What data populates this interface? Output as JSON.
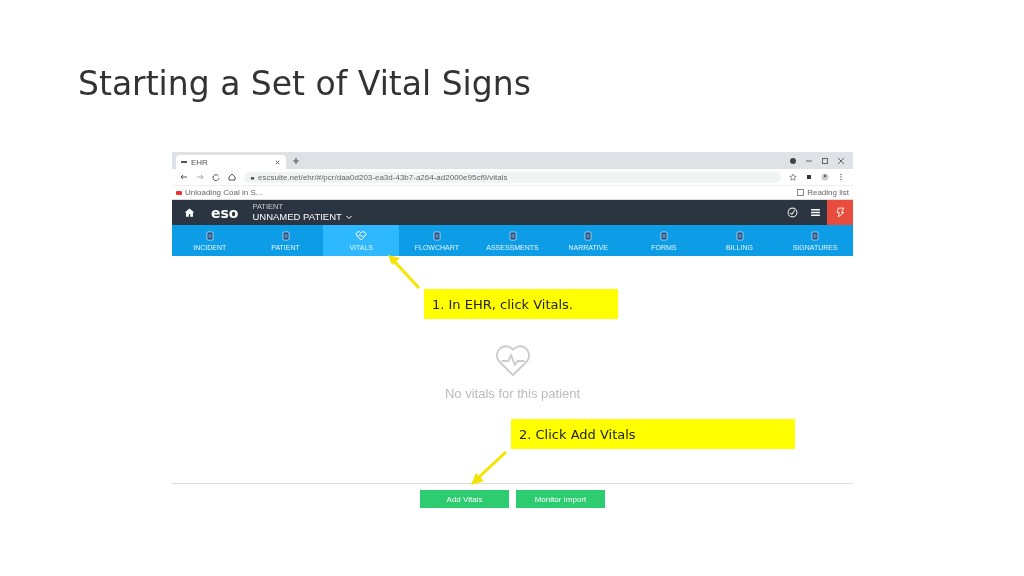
{
  "slide_title": "Starting a Set of Vital Signs",
  "browser": {
    "tab_title": "EHR",
    "url": "escsuite.net/ehr/#/pcr/daa0d203-ea3d-43b7-a264-ad2000e95cf9/vitals",
    "bookmark": "Unloading Coal in S...",
    "reading_list": "Reading list"
  },
  "app": {
    "logo": "eso",
    "patient_label": "PATIENT",
    "patient_name": "UNNAMED PATIENT"
  },
  "nav": [
    {
      "label": "INCIDENT",
      "selected": false
    },
    {
      "label": "PATIENT",
      "selected": false
    },
    {
      "label": "VITALS",
      "selected": true
    },
    {
      "label": "FLOWCHART",
      "selected": false
    },
    {
      "label": "ASSESSMENTS",
      "selected": false
    },
    {
      "label": "NARRATIVE",
      "selected": false
    },
    {
      "label": "FORMS",
      "selected": false
    },
    {
      "label": "BILLING",
      "selected": false
    },
    {
      "label": "SIGNATURES",
      "selected": false
    }
  ],
  "empty_state": "No vitals for this patient",
  "buttons": [
    "Add Vitals",
    "Monitor Import"
  ],
  "callouts": [
    "1.  In EHR, click Vitals.",
    "2.  Click Add Vitals"
  ]
}
